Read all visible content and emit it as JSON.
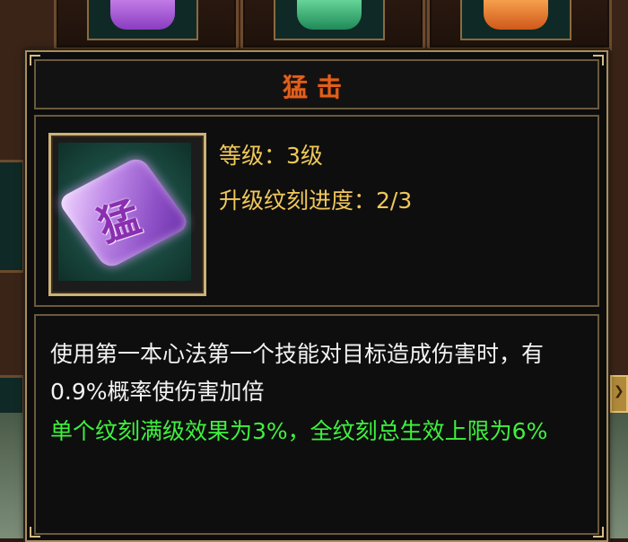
{
  "tooltip": {
    "title": "猛击",
    "icon": {
      "name": "skill-gem-icon",
      "char": "猛"
    },
    "level_label": "等级：3级",
    "progress_label": "升级纹刻进度：2/3",
    "description": "使用第一本心法第一个技能对目标造成伤害时，有0.9%概率使伤害加倍",
    "effect_note": "单个纹刻满级效果为3%，全纹刻总生效上限为6%"
  },
  "colors": {
    "title": "#e0601c",
    "stat_text": "#f0c85a",
    "description_text": "#f2f2f2",
    "effect_text": "#3ef23e",
    "frame": "#a88e5a"
  },
  "background_slots": [
    {
      "name": "gem-slot-purple",
      "color": "#b06ad8"
    },
    {
      "name": "gem-slot-green",
      "color": "#3fbf7a"
    },
    {
      "name": "gem-slot-orange",
      "color": "#e8862a"
    }
  ],
  "side_button": {
    "icon": "chevron-icon",
    "glyph": "❯"
  }
}
